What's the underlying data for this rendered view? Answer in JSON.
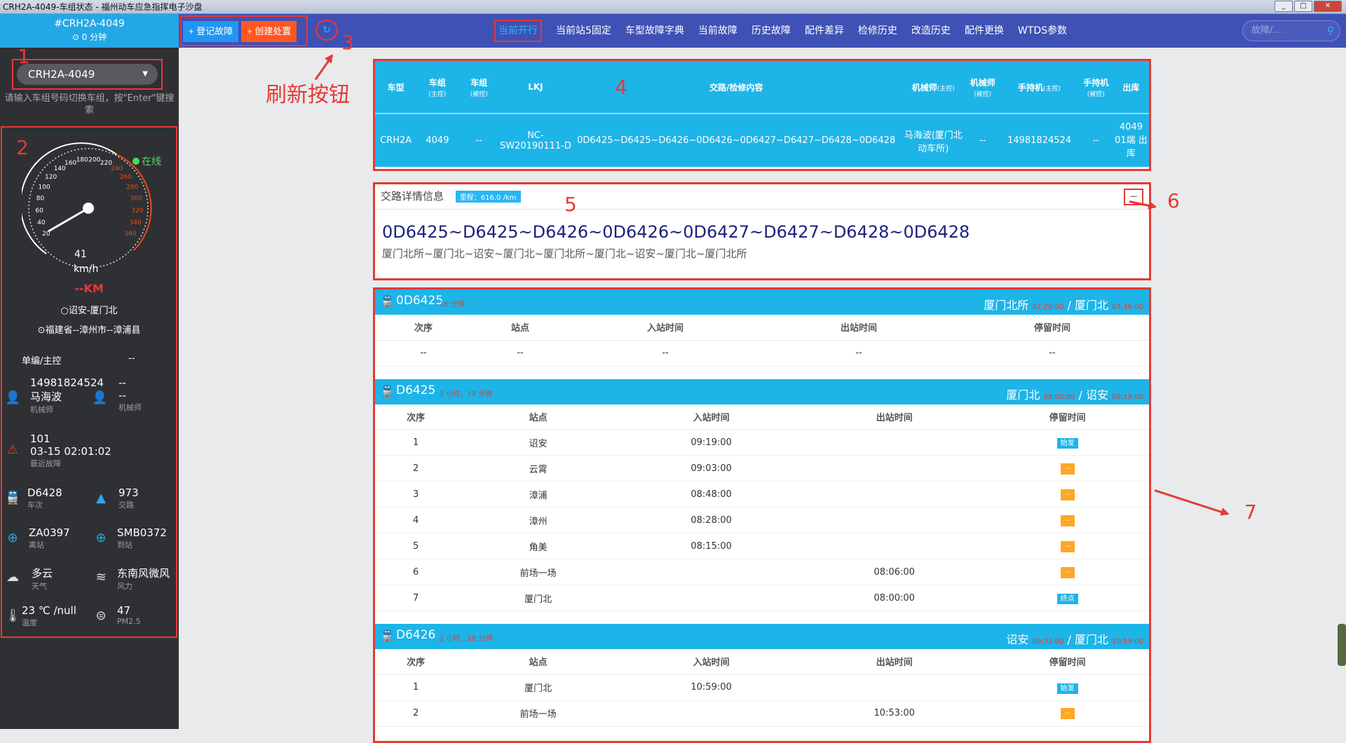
{
  "window": {
    "title": "CRH2A-4049-车组状态 - 福州动车应急指挥电子沙盘"
  },
  "sidebar": {
    "train_id": "#CRH2A-4049",
    "time_ago": "0 分钟",
    "select_value": "CRH2A-4049",
    "hint": "请输入车组号码切换车组，按\"Enter\"键搜索",
    "online": "在线",
    "speed": "41",
    "speed_unit": "km/h",
    "gauge_ticks": [
      "20",
      "40",
      "60",
      "80",
      "100",
      "120",
      "140",
      "160",
      "180",
      "200",
      "220",
      "240",
      "260",
      "280",
      "300",
      "320",
      "340",
      "360"
    ],
    "km": "--KM",
    "route": "诏安-厦门北",
    "location": "福建省--漳州市--漳浦县",
    "control_label": "单编/主控",
    "control_value": "--",
    "driver_phone": "14981824524",
    "driver_name": "马海波",
    "driver_label": "机械师",
    "driver2_phone": "--",
    "driver2_name": "--",
    "driver2_label": "机械师",
    "fault_count": "101",
    "fault_time": "03-15 02:01:02",
    "fault_label": "最近故障",
    "train_no": "D6428",
    "train_no_label": "车次",
    "route_no": "973",
    "route_no_label": "交路",
    "from_station": "ZA0397",
    "from_label": "离站",
    "to_station": "SMB0372",
    "to_label": "到站",
    "weather": "多云",
    "weather_label": "天气",
    "wind": "东南风微风",
    "wind_label": "风力",
    "temp": "23 ℃ /null",
    "temp_label": "温度",
    "pm": "47",
    "pm_label": "PM2.5"
  },
  "toolbar": {
    "register_fault": "+ 登记故障",
    "create_action": "+ 创建处置",
    "tabs": [
      "当前开行",
      "当前站5固定",
      "车型故障字典",
      "当前故障",
      "历史故障",
      "配件差异",
      "检修历史",
      "改造历史",
      "配件更换",
      "WTDS参数"
    ],
    "search_placeholder": "故障/..."
  },
  "annotations": {
    "n1": "1",
    "n2": "2",
    "n3": "3",
    "n4": "4",
    "n5": "5",
    "n6": "6",
    "n7": "7",
    "refresh_label": "刷新按钮"
  },
  "info_table": {
    "headers": [
      "车型",
      "车组",
      "车组",
      "LKJ",
      "交路/检修内容",
      "机械师",
      "机械师",
      "手持机",
      "手持机",
      "出库"
    ],
    "header_subs": [
      "",
      "(主控)",
      "(被控)",
      "",
      "",
      "(主控)",
      "(被控)",
      "(主控)",
      "(被控)",
      ""
    ],
    "row": [
      "CRH2A",
      "4049",
      "--",
      "NC-SW20190111-D",
      "0D6425~D6425~D6426~0D6426~0D6427~D6427~D6428~0D6428",
      "马海波(厦门北动车所)",
      "--",
      "14981824524",
      "--",
      "4049 01端 出库"
    ]
  },
  "route_detail": {
    "title": "交路详情信息",
    "mileage": "里程：616.0 /km",
    "collapse": "−",
    "sequence": "0D6425~D6425~D6426~0D6426~0D6427~D6427~D6428~0D6428",
    "stations": "厦门北所~厦门北~诏安~厦门北~厦门北所~厦门北~诏安~厦门北~厦门北所"
  },
  "trips": [
    {
      "no": "0D6425",
      "duration": "16 分钟",
      "from": "厦门北所",
      "from_time": "07:20:00",
      "to": "厦门北",
      "to_time": "07:36:00",
      "columns": [
        "次序",
        "站点",
        "入站时间",
        "出站时间",
        "停留时间"
      ],
      "rows": [
        [
          "--",
          "--",
          "--",
          "--",
          "--"
        ]
      ]
    },
    {
      "no": "D6425",
      "duration": "1 小时，19 分钟",
      "from": "厦门北",
      "from_time": "08:00:00",
      "to": "诏安",
      "to_time": "09:19:00",
      "columns": [
        "次序",
        "站点",
        "入站时间",
        "出站时间",
        "停留时间"
      ],
      "rows": [
        [
          "1",
          "诏安",
          "09:19:00",
          "",
          "始发"
        ],
        [
          "2",
          "云霄",
          "09:03:00",
          "",
          "--"
        ],
        [
          "3",
          "漳浦",
          "08:48:00",
          "",
          "--"
        ],
        [
          "4",
          "漳州",
          "08:28:00",
          "",
          "--"
        ],
        [
          "5",
          "角美",
          "08:15:00",
          "",
          "--"
        ],
        [
          "6",
          "前场一场",
          "",
          "08:06:00",
          "--"
        ],
        [
          "7",
          "厦门北",
          "",
          "08:00:00",
          "终点"
        ]
      ]
    },
    {
      "no": "D6426",
      "duration": "1 小时，28 分钟",
      "from": "诏安",
      "from_time": "09:31:00",
      "to": "厦门北",
      "to_time": "10:59:00",
      "columns": [
        "次序",
        "站点",
        "入站时间",
        "出站时间",
        "停留时间"
      ],
      "rows": [
        [
          "1",
          "厦门北",
          "10:59:00",
          "",
          "始发"
        ],
        [
          "2",
          "前场一场",
          "",
          "10:53:00",
          "--"
        ]
      ]
    }
  ]
}
